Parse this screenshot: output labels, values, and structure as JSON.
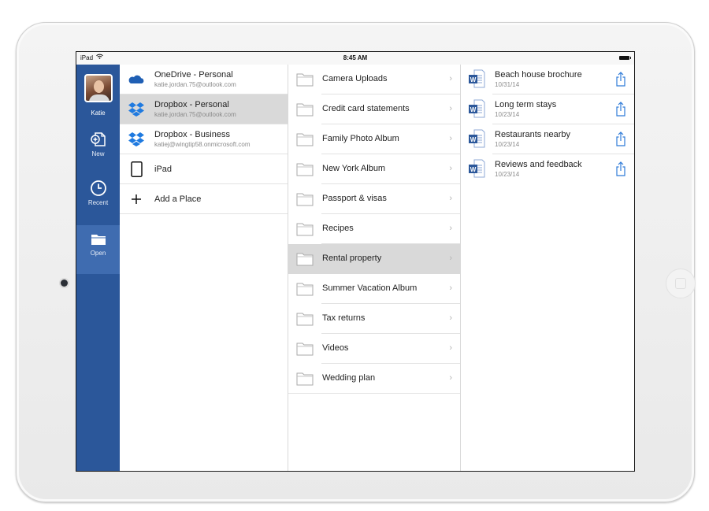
{
  "status_bar": {
    "device": "iPad",
    "time": "8:45 AM"
  },
  "nav_rail": {
    "user_name": "Katie",
    "items": [
      {
        "label": "New",
        "icon": "new-document-icon"
      },
      {
        "label": "Recent",
        "icon": "clock-icon"
      },
      {
        "label": "Open",
        "icon": "folder-open-icon",
        "active": true
      }
    ],
    "accent": "#2b579a"
  },
  "places": [
    {
      "name": "OneDrive - Personal",
      "email": "katie.jordan.75@outlook.com",
      "icon": "onedrive-cloud-icon"
    },
    {
      "name": "Dropbox - Personal",
      "email": "katie.jordan.75@outlook.com",
      "icon": "dropbox-icon",
      "selected": true
    },
    {
      "name": "Dropbox - Business",
      "email": "katiej@wingtip58.onmicrosoft.com",
      "icon": "dropbox-icon"
    },
    {
      "name": "iPad",
      "email": "",
      "icon": "tablet-icon"
    },
    {
      "name": "Add a Place",
      "email": "",
      "icon": "plus-icon"
    }
  ],
  "folders": [
    {
      "name": "Camera Uploads"
    },
    {
      "name": "Credit card statements"
    },
    {
      "name": "Family Photo Album"
    },
    {
      "name": "New York Album"
    },
    {
      "name": "Passport & visas"
    },
    {
      "name": "Recipes"
    },
    {
      "name": "Rental property",
      "selected": true
    },
    {
      "name": "Summer Vacation Album"
    },
    {
      "name": "Tax returns"
    },
    {
      "name": "Videos"
    },
    {
      "name": "Wedding plan"
    }
  ],
  "files": [
    {
      "name": "Beach house brochure",
      "date": "10/31/14"
    },
    {
      "name": "Long term stays",
      "date": "10/23/14"
    },
    {
      "name": "Restaurants nearby",
      "date": "10/23/14"
    },
    {
      "name": "Reviews and feedback",
      "date": "10/23/14"
    }
  ],
  "colors": {
    "dropbox": "#1f7ae0",
    "onedrive": "#1f5fb4",
    "word": "#2b579a",
    "share": "#2f7bd8",
    "selected_row": "#d9d9d9"
  }
}
